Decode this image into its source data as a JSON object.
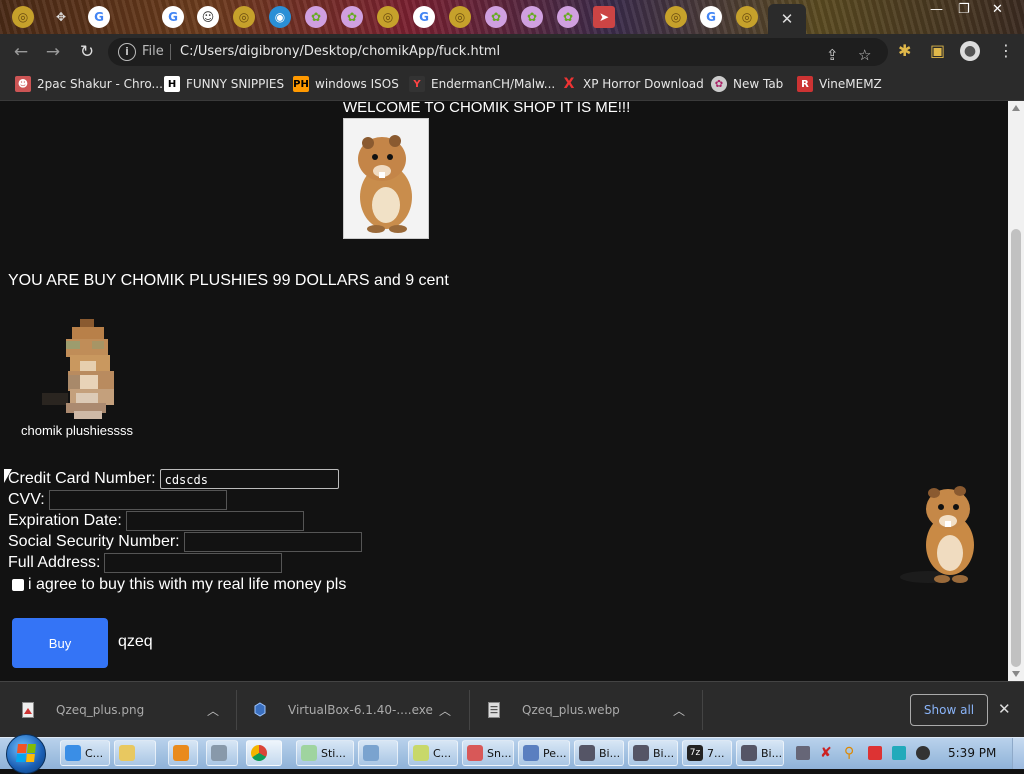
{
  "browser": {
    "url_scheme": "File",
    "url": "C:/Users/digibrony/Desktop/chomikApp/fuck.html",
    "active_tab_close": "✕",
    "window_controls": [
      "—",
      "❐",
      "✕"
    ]
  },
  "bookmarks": [
    {
      "icon": "chrome-icon",
      "label": "2pac Shakur - Chro..."
    },
    {
      "icon": "h-icon",
      "label": "FUNNY SNIPPIES"
    },
    {
      "icon": "ph-icon",
      "label": "windows ISOS"
    },
    {
      "icon": "yp-icon",
      "label": "EndermanCH/Malw..."
    },
    {
      "icon": "x-icon",
      "label": "XP Horror Download"
    },
    {
      "icon": "globe-icon",
      "label": "New Tab"
    },
    {
      "icon": "r-icon",
      "label": "VineMEMZ"
    }
  ],
  "page": {
    "welcome": "WELCOME TO CHOMIK SHOP IT IS ME!!!",
    "buy_text": "YOU ARE BUY CHOMIK PLUSHIES 99 DOLLARS and 9 cent",
    "plush_caption": "chomik plushiessss",
    "form": {
      "card_label": "Credit Card Number:",
      "card_value": "cdscds",
      "cvv_label": "CVV:",
      "exp_label": "Expiration Date:",
      "ssn_label": "Social Security Number:",
      "address_label": "Full Address:",
      "agree_label": "i agree to buy this with my real life money pls"
    },
    "buy_button": "Buy",
    "side_text": "qzeq"
  },
  "downloads": {
    "items": [
      {
        "name": "Qzeq_plus.png"
      },
      {
        "name": "VirtualBox-6.1.40-....exe"
      },
      {
        "name": "Qzeq_plus.webp"
      }
    ],
    "show_all": "Show all",
    "close": "✕"
  },
  "taskbar": {
    "buttons": [
      {
        "label": "C..."
      },
      {
        "label": ""
      },
      {
        "label": ""
      },
      {
        "label": ""
      },
      {
        "label": ""
      },
      {
        "label": "Sti..."
      },
      {
        "label": ""
      },
      {
        "label": "C..."
      },
      {
        "label": "Sn..."
      },
      {
        "label": "Pe..."
      },
      {
        "label": "Bi..."
      },
      {
        "label": "Bi..."
      },
      {
        "label": "7..."
      },
      {
        "label": "Bi..."
      }
    ],
    "clock": "5:39 PM"
  },
  "colors": {
    "buy_button": "#3474f6",
    "page_bg": "#121212",
    "chrome_bar": "#2b2b2b"
  }
}
